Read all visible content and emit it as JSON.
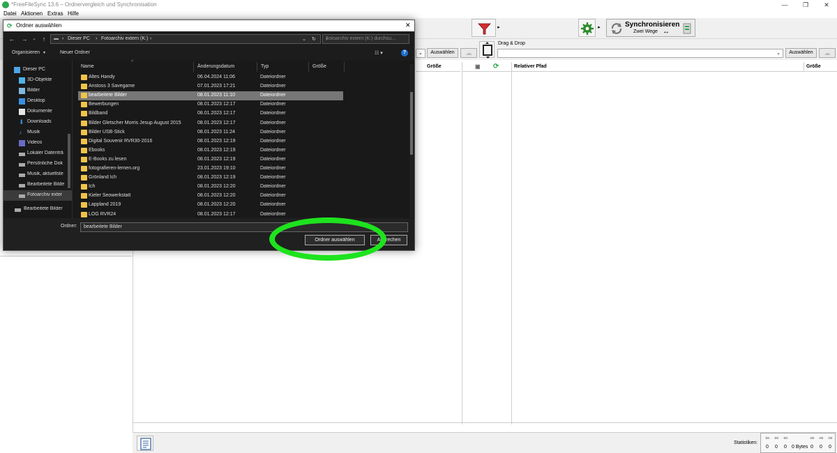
{
  "window": {
    "title": "*FreeFileSync 13.6 – Ordnervergleich und Synchronisation",
    "controls": [
      "—",
      "❐",
      "✕"
    ]
  },
  "menu": [
    "Datei",
    "Aktionen",
    "Extras",
    "Hilfe"
  ],
  "toolbar": {
    "sync_label": "Synchronisieren",
    "sync_sub": "Zwei Wege",
    "sync_sub_symbol": "↔"
  },
  "folderbar": {
    "left_browse": "Auswählen",
    "right_label": "Drag & Drop",
    "right_browse": "Auswählen"
  },
  "grid": {
    "left_size": "Größe",
    "right_path": "Relativer Pfad",
    "right_size": "Größe"
  },
  "statusbar": {
    "label": "Statistiken:",
    "counts": [
      "0",
      "0",
      "0",
      "0 Bytes",
      "0",
      "0",
      "0"
    ]
  },
  "dialog": {
    "title": "Ordner auswählen",
    "address": [
      "Dieser PC",
      "Fotoarchiv extern (K:)"
    ],
    "search_placeholder": "Fotoarchiv extern (K:) durchsu...",
    "organize": "Organisieren",
    "new_folder": "Neuer Ordner",
    "nav_items": [
      {
        "label": "Dieser PC",
        "icon": "computer-icon"
      },
      {
        "label": "3D-Objekte",
        "icon": "cube-icon"
      },
      {
        "label": "Bilder",
        "icon": "pictures-icon"
      },
      {
        "label": "Desktop",
        "icon": "desktop-icon"
      },
      {
        "label": "Dokumente",
        "icon": "documents-icon"
      },
      {
        "label": "Downloads",
        "icon": "download-icon"
      },
      {
        "label": "Musik",
        "icon": "music-icon"
      },
      {
        "label": "Videos",
        "icon": "video-icon"
      },
      {
        "label": "Lokaler Datenträ",
        "icon": "drive-icon"
      },
      {
        "label": "Persönliche Dok",
        "icon": "drive-icon"
      },
      {
        "label": "Musik, aktuellste",
        "icon": "drive-icon"
      },
      {
        "label": "Bearbeitete Bilde",
        "icon": "drive-icon"
      },
      {
        "label": "Fotoarchiv exter",
        "icon": "drive-icon"
      },
      {
        "label": "Bearbeitete Bilder",
        "icon": "drive-icon"
      }
    ],
    "columns": [
      "Name",
      "Änderungsdatum",
      "Typ",
      "Größe"
    ],
    "files": [
      {
        "name": "Altes Handy",
        "date": "06.04.2024 11:06",
        "type": "Dateiordner"
      },
      {
        "name": "Anstoss 3 Savegame",
        "date": "07.01.2023 17:21",
        "type": "Dateiordner"
      },
      {
        "name": "bearbeitete Bilder",
        "date": "08.01.2023 11:10",
        "type": "Dateiordner",
        "selected": true
      },
      {
        "name": "Bewerbungen",
        "date": "08.01.2023 12:17",
        "type": "Dateiordner"
      },
      {
        "name": "Bildband",
        "date": "08.01.2023 12:17",
        "type": "Dateiordner"
      },
      {
        "name": "Bilder Gletscher Morris Jesup August 2015",
        "date": "08.01.2023 12:17",
        "type": "Dateiordner"
      },
      {
        "name": "Bilder USB-Stick",
        "date": "08.01.2023 11:24",
        "type": "Dateiordner"
      },
      {
        "name": "Digital Souvenir RVR30-2016",
        "date": "08.01.2023 12:19",
        "type": "Dateiordner"
      },
      {
        "name": "Ebooks",
        "date": "08.01.2023 12:19",
        "type": "Dateiordner"
      },
      {
        "name": "E-Books zu lesen",
        "date": "08.01.2023 12:19",
        "type": "Dateiordner"
      },
      {
        "name": "fotografieren-lernen.org",
        "date": "23.01.2023 19:10",
        "type": "Dateiordner"
      },
      {
        "name": "Grönland Ich",
        "date": "08.01.2023 12:19",
        "type": "Dateiordner"
      },
      {
        "name": "Ich",
        "date": "08.01.2023 12:20",
        "type": "Dateiordner"
      },
      {
        "name": "Kieler Seowerkstatt",
        "date": "08.01.2023 12:20",
        "type": "Dateiordner"
      },
      {
        "name": "Lappland 2019",
        "date": "08.01.2023 12:20",
        "type": "Dateiordner"
      },
      {
        "name": "LOG RVR24",
        "date": "08.01.2023 12:17",
        "type": "Dateiordner"
      }
    ],
    "folder_label": "Ordner:",
    "folder_value": "bearbeitete Bilder",
    "select_button": "Ordner auswählen",
    "cancel_button": "Abbrechen"
  },
  "colors": {
    "dialog_bg": "#202020",
    "folder_icon": "#f1c34c",
    "highlight": "#1ee31e",
    "sync_green": "#2fa84f",
    "filter_red": "#d32f2f"
  }
}
